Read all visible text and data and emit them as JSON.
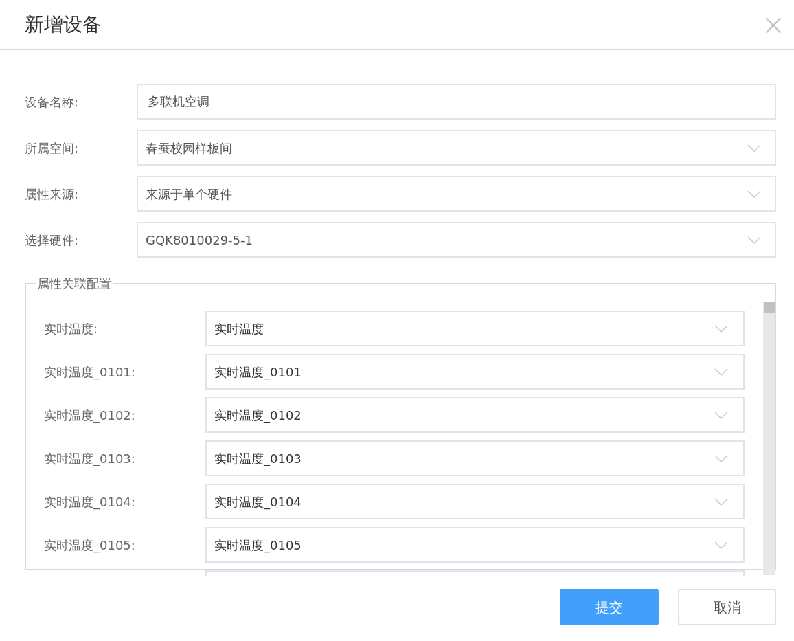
{
  "dialog": {
    "title": "新增设备",
    "close": "×"
  },
  "fields": [
    {
      "kind": "input",
      "label": "设备名称:",
      "value": "多联机空调"
    },
    {
      "kind": "select",
      "label": "所属空间:",
      "value": "春蚕校园样板间"
    },
    {
      "kind": "select",
      "label": "属性来源:",
      "value": "来源于单个硬件"
    },
    {
      "kind": "select",
      "label": "选择硬件:",
      "value": "GQK8010029-5-1"
    }
  ],
  "attribute_group": {
    "title": "属性关联配置",
    "rows": [
      {
        "label": "实时温度:",
        "value": "实时温度"
      },
      {
        "label": "实时温度_0101:",
        "value": "实时温度_0101"
      },
      {
        "label": "实时温度_0102:",
        "value": "实时温度_0102"
      },
      {
        "label": "实时温度_0103:",
        "value": "实时温度_0103"
      },
      {
        "label": "实时温度_0104:",
        "value": "实时温度_0104"
      },
      {
        "label": "实时温度_0105:",
        "value": "实时温度_0105"
      }
    ]
  },
  "buttons": [
    {
      "kind": "primary",
      "label": "提交"
    },
    {
      "kind": "default",
      "label": "取消"
    }
  ]
}
